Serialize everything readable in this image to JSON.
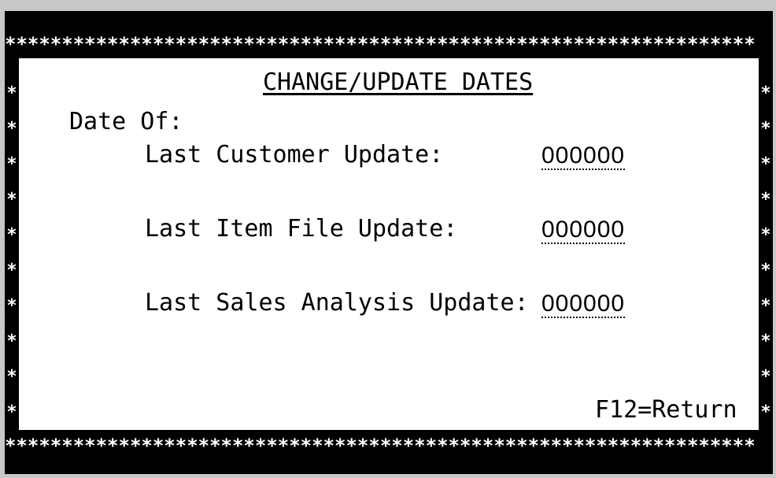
{
  "border": {
    "top_stars": "******************************************************************",
    "bottom_stars": "******************************************************************",
    "side_star": "*"
  },
  "screen": {
    "title": "CHANGE/UPDATE DATES",
    "section_label": "Date Of:",
    "fields": [
      {
        "label": "Last Customer Update:",
        "value": "000000"
      },
      {
        "label": "Last Item File Update:",
        "value": "000000"
      },
      {
        "label": "Last Sales Analysis Update:",
        "value": "000000"
      }
    ],
    "function_key": "F12=Return"
  }
}
